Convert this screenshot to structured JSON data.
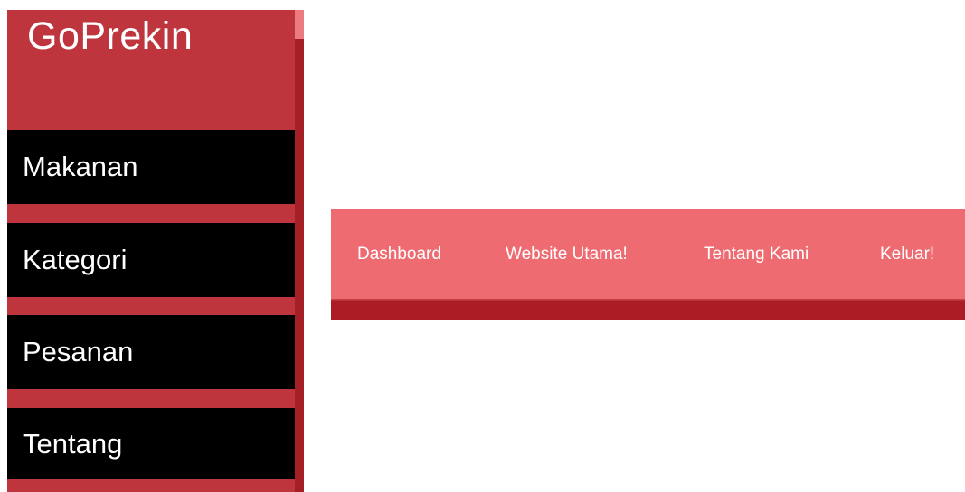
{
  "sidebar": {
    "brand": "GoPrekin",
    "items": [
      {
        "label": "Makanan"
      },
      {
        "label": "Kategori"
      },
      {
        "label": "Pesanan"
      },
      {
        "label": "Tentang"
      }
    ]
  },
  "navbar": {
    "links": [
      {
        "label": "Dashboard"
      },
      {
        "label": "Website Utama!"
      },
      {
        "label": "Tentang Kami"
      },
      {
        "label": "Keluar!"
      }
    ]
  },
  "colors": {
    "sidebar_bg": "#be353d",
    "menu_item_bg": "#000000",
    "navbar_bg": "#ee6b71",
    "navbar_bottom": "#ab1c24",
    "text": "#ffffff"
  }
}
